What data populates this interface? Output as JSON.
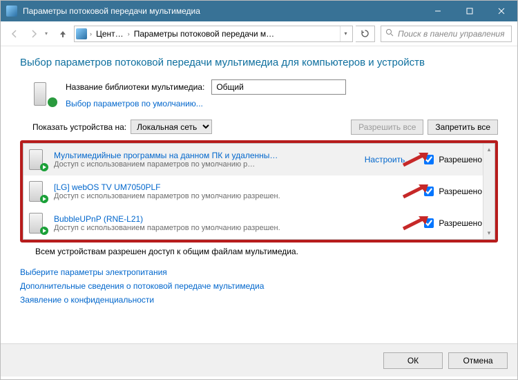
{
  "window": {
    "title": "Параметры потоковой передачи мультимедиа"
  },
  "nav": {
    "crumb1": "Цент…",
    "crumb2": "Параметры потоковой передачи м…",
    "search_placeholder": "Поиск в панели управления"
  },
  "heading": "Выбор параметров потоковой передачи мультимедиа для компьютеров и устройств",
  "library": {
    "label": "Название библиотеки мультимедиа:",
    "value": "Общий",
    "defaults_link": "Выбор параметров по умолчанию..."
  },
  "show_devices": {
    "label": "Показать устройства на:",
    "selected": "Локальная сеть",
    "allow_all": "Разрешить все",
    "block_all": "Запретить все"
  },
  "devices": [
    {
      "title": "Мультимедийные программы на данном ПК и удаленны…",
      "sub": "Доступ с использованием параметров по умолчанию р…",
      "configure": "Настроить...",
      "allowed_label": "Разрешено",
      "allowed": true,
      "selected": true
    },
    {
      "title": "[LG] webOS TV UM7050PLF",
      "sub": "Доступ с использованием параметров по умолчанию разрешен.",
      "allowed_label": "Разрешено",
      "allowed": true,
      "selected": false
    },
    {
      "title": "BubbleUPnP (RNE-L21)",
      "sub": "Доступ с использованием параметров по умолчанию разрешен.",
      "allowed_label": "Разрешено",
      "allowed": true,
      "selected": false
    }
  ],
  "status": "Всем устройствам разрешен доступ к общим файлам мультимедиа.",
  "links": {
    "power": "Выберите параметры электропитания",
    "more": "Дополнительные сведения о потоковой передаче мультимедиа",
    "privacy": "Заявление о конфиденциальности"
  },
  "footer": {
    "ok": "ОК",
    "cancel": "Отмена"
  }
}
